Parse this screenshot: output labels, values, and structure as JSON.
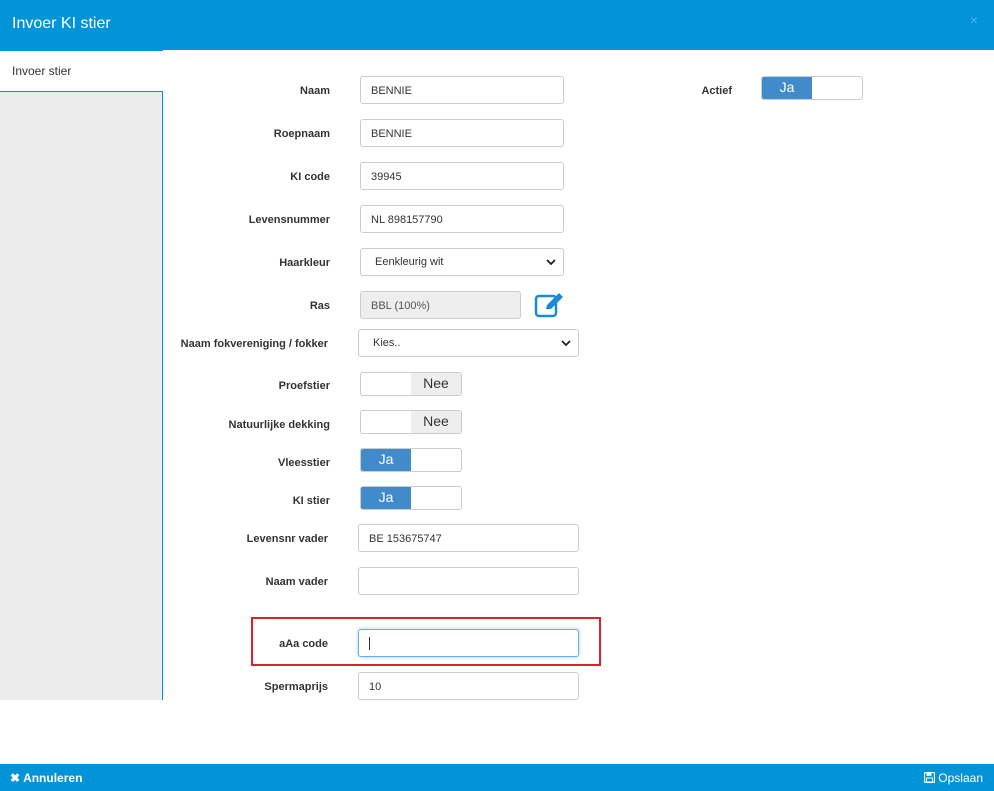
{
  "header": {
    "title": "Invoer KI stier",
    "close_symbol": "×"
  },
  "sidebar": {
    "tab_label": "Invoer stier"
  },
  "form": {
    "naam": {
      "label": "Naam",
      "value": "BENNIE"
    },
    "roepnaam": {
      "label": "Roepnaam",
      "value": "BENNIE"
    },
    "ki_code": {
      "label": "KI code",
      "value": "39945"
    },
    "levensnummer": {
      "label": "Levensnummer",
      "value": "NL 898157790"
    },
    "haarkleur": {
      "label": "Haarkleur",
      "value": "Eenkleurig wit"
    },
    "ras": {
      "label": "Ras",
      "value": "BBL (100%)"
    },
    "fokvereniging": {
      "label": "Naam fokvereniging / fokker",
      "value": "Kies.."
    },
    "proefstier": {
      "label": "Proefstier",
      "state": "Nee"
    },
    "natuurlijke_dekking": {
      "label": "Natuurlijke dekking",
      "state": "Nee"
    },
    "vleesstier": {
      "label": "Vleesstier",
      "state": "Ja"
    },
    "ki_stier": {
      "label": "KI stier",
      "state": "Ja"
    },
    "levensnr_vader": {
      "label": "Levensnr vader",
      "value": "BE 153675747"
    },
    "naam_vader": {
      "label": "Naam vader",
      "value": ""
    },
    "aaa_code": {
      "label": "aAa code",
      "value": ""
    },
    "spermaprijs": {
      "label": "Spermaprijs",
      "value": "10"
    },
    "actief": {
      "label": "Actief",
      "state": "Ja"
    }
  },
  "footer": {
    "cancel_label": "Annuleren",
    "save_label": "Opslaan"
  },
  "colors": {
    "header_blue": "#0394d8",
    "toggle_on": "#428bca",
    "highlight_red": "#d9232d"
  }
}
